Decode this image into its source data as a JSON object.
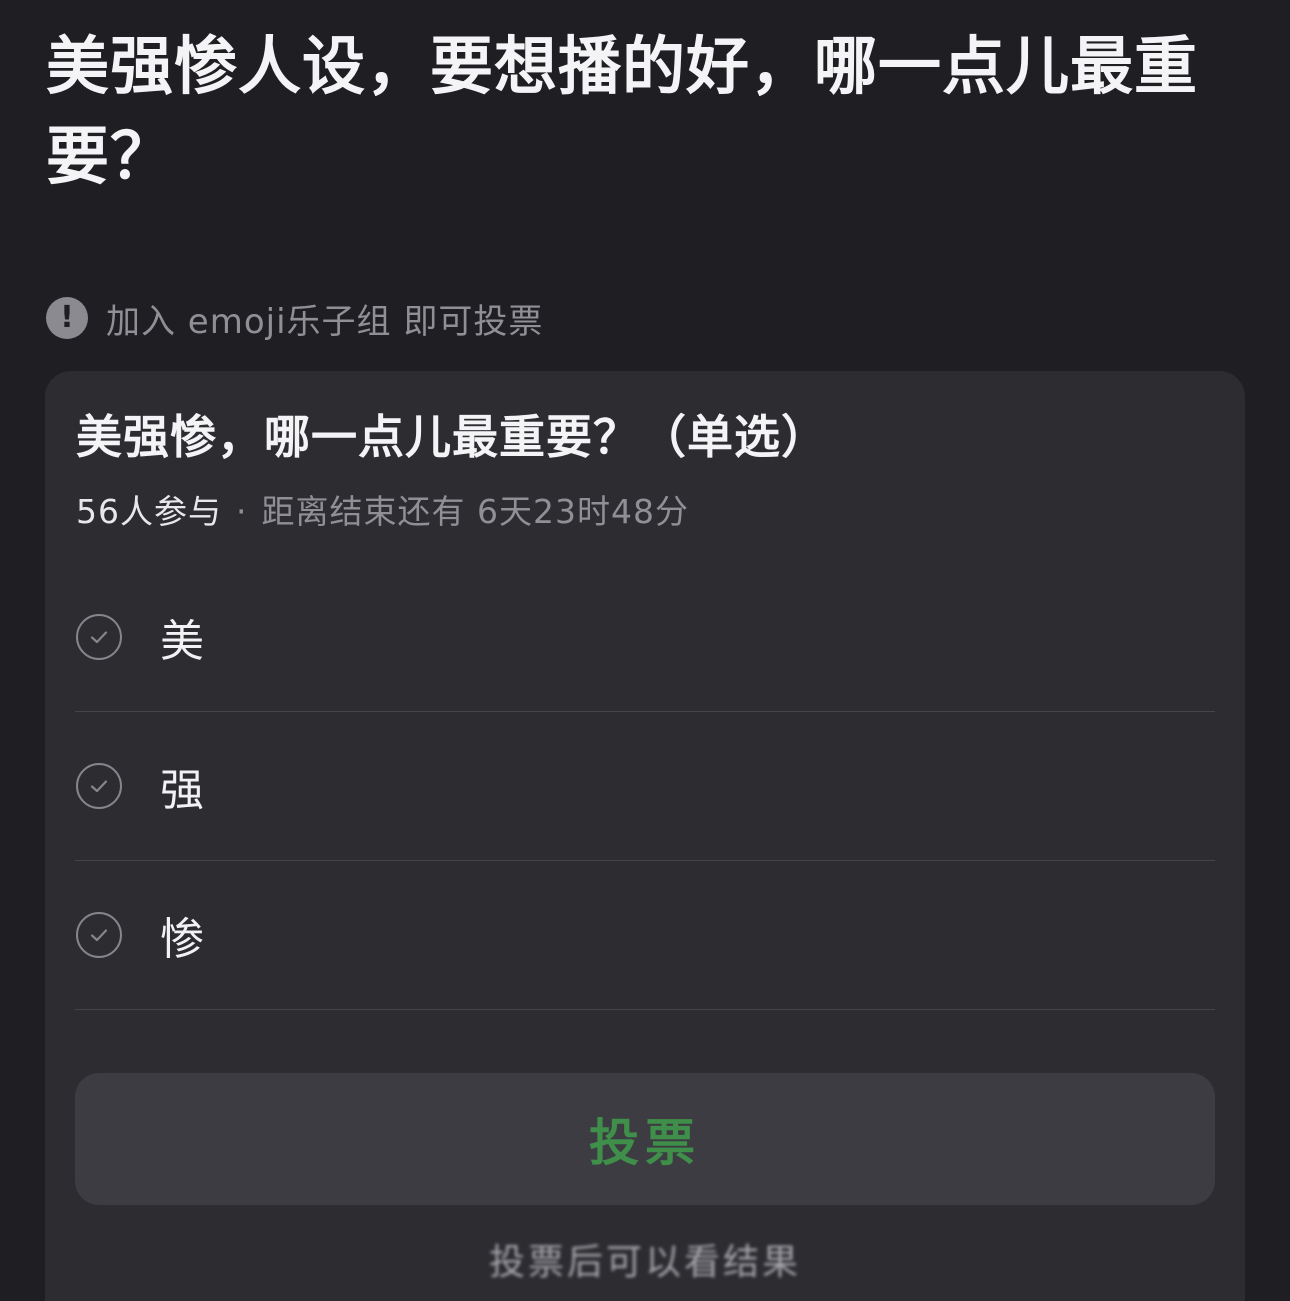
{
  "post": {
    "title": "美强惨人设，要想播的好，哪一点儿最重要？"
  },
  "notice": {
    "icon": "exclamation-circle-icon",
    "text": "加入 emoji乐子组 即可投票"
  },
  "poll": {
    "question": "美强惨，哪一点儿最重要？（单选）",
    "participants": "56人参与",
    "separator": "·",
    "time_remaining": "距离结束还有 6天23时48分",
    "options": [
      {
        "label": "美",
        "icon": "check-circle-icon"
      },
      {
        "label": "强",
        "icon": "check-circle-icon"
      },
      {
        "label": "惨",
        "icon": "check-circle-icon"
      }
    ],
    "vote_label": "投票",
    "result_hint": "投票后可以看结果"
  },
  "colors": {
    "background": "#1f1f23",
    "card": "#2c2c31",
    "button": "#3c3c42",
    "accent_green": "#3f8f4a",
    "muted_text": "#8f8f95"
  }
}
